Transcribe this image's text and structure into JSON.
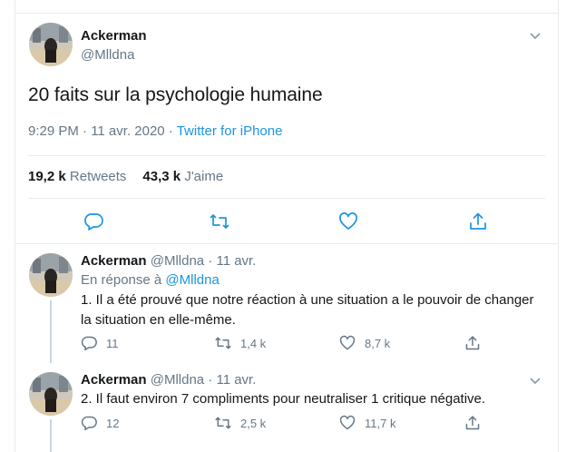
{
  "colors": {
    "accent": "#1b95e0",
    "muted": "#657786",
    "text": "#14171a",
    "border": "#e6ecf0"
  },
  "main_tweet": {
    "author_name": "Ackerman",
    "author_handle": "@Mlldna",
    "text": "20 faits sur la psychologie humaine",
    "time": "9:29 PM · 11 avr. 2020 · ",
    "source": "Twitter for iPhone",
    "retweets_count": "19,2 k",
    "retweets_label": "Retweets",
    "likes_count": "43,3 k",
    "likes_label": "J'aime",
    "icons": [
      "reply-icon",
      "retweet-icon",
      "like-icon",
      "share-icon",
      "chevron-down-icon"
    ]
  },
  "replies": [
    {
      "author_name": "Ackerman",
      "meta": "@Mlldna · 11 avr.",
      "in_reply_prefix": "En réponse à ",
      "in_reply_mention": "@Mlldna",
      "text": "1. Il a été prouvé que notre réaction à une situation a le pouvoir de changer la situation en elle-même.",
      "replies": "11",
      "retweets": "1,4 k",
      "likes": "8,7 k"
    },
    {
      "author_name": "Ackerman",
      "meta": "@Mlldna · 11 avr.",
      "text": "2. Il faut environ 7 compliments pour neutraliser 1 critique négative.",
      "replies": "12",
      "retweets": "2,5 k",
      "likes": "11,7 k"
    }
  ]
}
